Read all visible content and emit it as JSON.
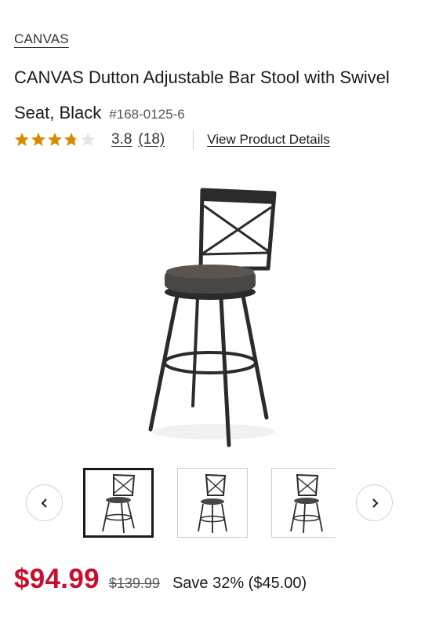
{
  "product": {
    "brand": "CANVAS",
    "title": "CANVAS Dutton Adjustable Bar Stool with Swivel Seat, Black",
    "sku": "#168-0125-6"
  },
  "rating": {
    "value": "3.8",
    "count": "(18)",
    "stars_filled_fraction": 0.76,
    "star_color": "#d98a00"
  },
  "links": {
    "view_details": "View Product Details"
  },
  "gallery": {
    "main_image_icon": "bar-stool-image",
    "thumbnail_count": 3,
    "active_thumbnail_index": 0,
    "prev_icon": "chevron-left-icon",
    "next_icon": "chevron-right-icon"
  },
  "pricing": {
    "price": "$94.99",
    "was_price": "$139.99",
    "savings": "Save 32% ($45.00)",
    "price_color": "#c8102e"
  }
}
